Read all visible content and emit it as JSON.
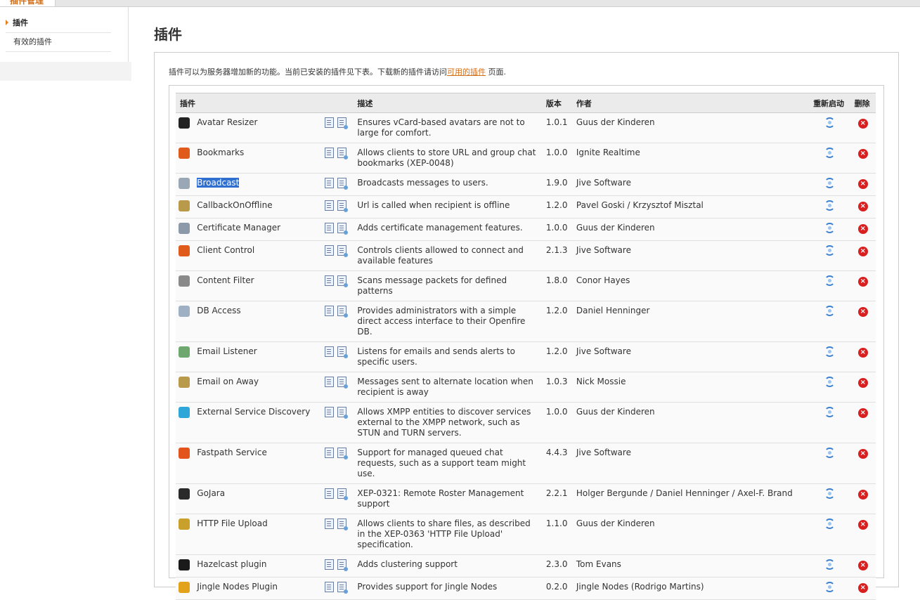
{
  "top_tab": {
    "label": "插件管理"
  },
  "sidebar": {
    "items": [
      {
        "label": "插件",
        "active": true
      },
      {
        "label": "有效的插件",
        "active": false
      }
    ]
  },
  "page_title": "插件",
  "intro": {
    "text_before": "插件可以为服务器增加新的功能。当前已安装的插件见下表。下载新的插件请访问",
    "link": "可用的插件",
    "text_after": " 页面."
  },
  "table": {
    "headers": {
      "plugin": "插件",
      "desc": "描述",
      "version": "版本",
      "author": "作者",
      "restart": "重新启动",
      "delete": "删除"
    },
    "rows": [
      {
        "name": "Avatar Resizer",
        "desc": "Ensures vCard-based avatars are not to large for comfort.",
        "version": "1.0.1",
        "author": "Guus der Kinderen",
        "icon": "avatar-resizer-icon",
        "color": "#222222"
      },
      {
        "name": "Bookmarks",
        "desc": "Allows clients to store URL and group chat bookmarks (XEP-0048)",
        "version": "1.0.0",
        "author": "Ignite Realtime",
        "icon": "bookmarks-icon",
        "color": "#e05a1c"
      },
      {
        "name": "Broadcast",
        "desc": "Broadcasts messages to users.",
        "version": "1.9.0",
        "author": "Jive Software",
        "icon": "broadcast-icon",
        "color": "#9aa7b5",
        "selected": true
      },
      {
        "name": "CallbackOnOffline",
        "desc": "Url is called when recipient is offline",
        "version": "1.2.0",
        "author": "Pavel Goski / Krzysztof Misztal",
        "icon": "callback-icon",
        "color": "#b89a4a"
      },
      {
        "name": "Certificate Manager",
        "desc": "Adds certificate management features.",
        "version": "1.0.0",
        "author": "Guus der Kinderen",
        "icon": "certificate-icon",
        "color": "#8c99a8"
      },
      {
        "name": "Client Control",
        "desc": "Controls clients allowed to connect and available features",
        "version": "2.1.3",
        "author": "Jive Software",
        "icon": "client-control-icon",
        "color": "#e05a1c"
      },
      {
        "name": "Content Filter",
        "desc": "Scans message packets for defined patterns",
        "version": "1.8.0",
        "author": "Conor Hayes",
        "icon": "filter-icon",
        "color": "#8a8a8a"
      },
      {
        "name": "DB Access",
        "desc": "Provides administrators with a simple direct access interface to their Openfire DB.",
        "version": "1.2.0",
        "author": "Daniel Henninger",
        "icon": "db-access-icon",
        "color": "#9fb0c4"
      },
      {
        "name": "Email Listener",
        "desc": "Listens for emails and sends alerts to specific users.",
        "version": "1.2.0",
        "author": "Jive Software",
        "icon": "email-listener-icon",
        "color": "#6fa86f"
      },
      {
        "name": "Email on Away",
        "desc": "Messages sent to alternate location when recipient is away",
        "version": "1.0.3",
        "author": "Nick Mossie",
        "icon": "email-away-icon",
        "color": "#b89a4a"
      },
      {
        "name": "External Service Discovery",
        "desc": "Allows XMPP entities to discover services external to the XMPP network, such as STUN and TURN servers.",
        "version": "1.0.0",
        "author": "Guus der Kinderen",
        "icon": "globe-icon",
        "color": "#2fa6d8"
      },
      {
        "name": "Fastpath Service",
        "desc": "Support for managed queued chat requests, such as a support team might use.",
        "version": "4.4.3",
        "author": "Jive Software",
        "icon": "fastpath-icon",
        "color": "#e3531c"
      },
      {
        "name": "GoJara",
        "desc": "XEP-0321: Remote Roster Management support",
        "version": "2.2.1",
        "author": "Holger Bergunde / Daniel Henninger / Axel-F. Brand",
        "icon": "gojara-icon",
        "color": "#2a2a2a"
      },
      {
        "name": "HTTP File Upload",
        "desc": "Allows clients to share files, as described in the XEP-0363 'HTTP File Upload' specification.",
        "version": "1.1.0",
        "author": "Guus der Kinderen",
        "icon": "file-upload-icon",
        "color": "#c8a02a"
      },
      {
        "name": "Hazelcast plugin",
        "desc": "Adds clustering support",
        "version": "2.3.0",
        "author": "Tom Evans",
        "icon": "hazelcast-icon",
        "color": "#1a1a1a"
      },
      {
        "name": "Jingle Nodes Plugin",
        "desc": "Provides support for Jingle Nodes",
        "version": "0.2.0",
        "author": "Jingle Nodes (Rodrigo Martins)",
        "icon": "jingle-nodes-icon",
        "color": "#e3a21c"
      }
    ]
  }
}
